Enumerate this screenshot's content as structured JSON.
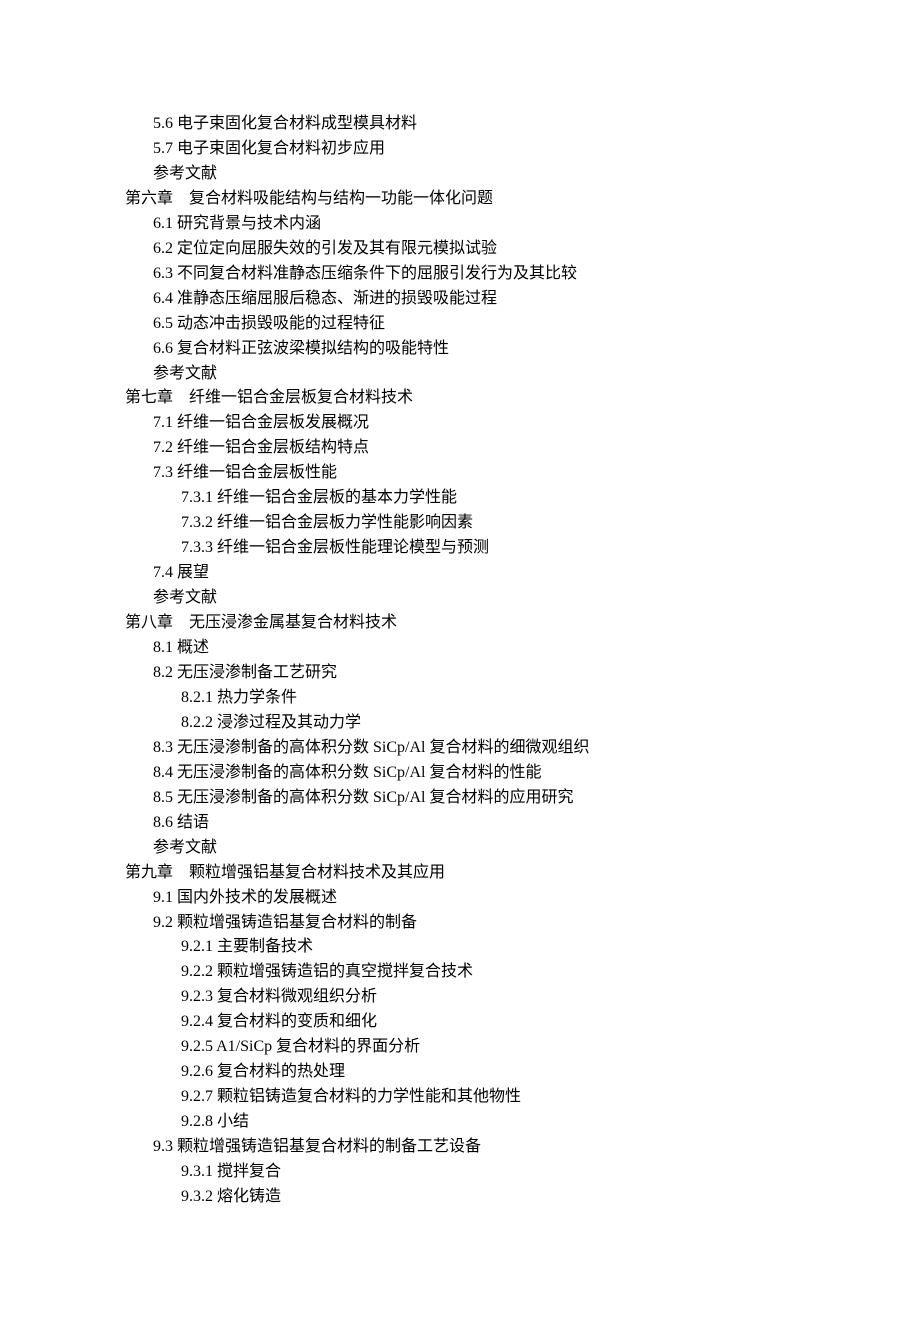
{
  "lines": [
    {
      "indent": 1,
      "text": "5.6 电子束固化复合材料成型模具材料"
    },
    {
      "indent": 1,
      "text": "5.7 电子束固化复合材料初步应用"
    },
    {
      "indent": 1,
      "text": "参考文献"
    },
    {
      "indent": 0,
      "text": "第六章　复合材料吸能结构与结构一功能一体化问题"
    },
    {
      "indent": 1,
      "text": "6.1 研究背景与技术内涵"
    },
    {
      "indent": 1,
      "text": "6.2 定位定向屈服失效的引发及其有限元模拟试验"
    },
    {
      "indent": 1,
      "text": "6.3 不同复合材料准静态压缩条件下的屈服引发行为及其比较"
    },
    {
      "indent": 1,
      "text": "6.4 准静态压缩屈服后稳态、渐进的损毁吸能过程"
    },
    {
      "indent": 1,
      "text": "6.5 动态冲击损毁吸能的过程特征"
    },
    {
      "indent": 1,
      "text": "6.6 复合材料正弦波梁模拟结构的吸能特性"
    },
    {
      "indent": 1,
      "text": "参考文献"
    },
    {
      "indent": 0,
      "text": "第七章　纤维一铝合金层板复合材料技术"
    },
    {
      "indent": 1,
      "text": "7.1 纤维一铝合金层板发展概况"
    },
    {
      "indent": 1,
      "text": "7.2 纤维一铝合金层板结构特点"
    },
    {
      "indent": 1,
      "text": "7.3 纤维一铝合金层板性能"
    },
    {
      "indent": 2,
      "text": "7.3.1 纤维一铝合金层板的基本力学性能"
    },
    {
      "indent": 2,
      "text": "7.3.2 纤维一铝合金层板力学性能影响因素"
    },
    {
      "indent": 2,
      "text": "7.3.3 纤维一铝合金层板性能理论模型与预测"
    },
    {
      "indent": 1,
      "text": "7.4 展望"
    },
    {
      "indent": 1,
      "text": "参考文献"
    },
    {
      "indent": 0,
      "text": "第八章　无压浸渗金属基复合材料技术"
    },
    {
      "indent": 1,
      "text": "8.1 概述"
    },
    {
      "indent": 1,
      "text": "8.2 无压浸渗制备工艺研究"
    },
    {
      "indent": 2,
      "text": "8.2.1 热力学条件"
    },
    {
      "indent": 2,
      "text": "8.2.2 浸渗过程及其动力学"
    },
    {
      "indent": 1,
      "text": "8.3 无压浸渗制备的高体积分数 SiCp/Al 复合材料的细微观组织"
    },
    {
      "indent": 1,
      "text": "8.4 无压浸渗制备的高体积分数 SiCp/Al 复合材料的性能"
    },
    {
      "indent": 1,
      "text": "8.5 无压浸渗制备的高体积分数 SiCp/Al 复合材料的应用研究"
    },
    {
      "indent": 1,
      "text": "8.6 结语"
    },
    {
      "indent": 1,
      "text": "参考文献"
    },
    {
      "indent": 0,
      "text": "第九章　颗粒增强铝基复合材料技术及其应用"
    },
    {
      "indent": 1,
      "text": "9.1 国内外技术的发展概述"
    },
    {
      "indent": 1,
      "text": "9.2 颗粒增强铸造铝基复合材料的制备"
    },
    {
      "indent": 2,
      "text": "9.2.1 主要制备技术"
    },
    {
      "indent": 2,
      "text": "9.2.2 颗粒增强铸造铝的真空搅拌复合技术"
    },
    {
      "indent": 2,
      "text": "9.2.3 复合材料微观组织分析"
    },
    {
      "indent": 2,
      "text": "9.2.4 复合材料的变质和细化"
    },
    {
      "indent": 2,
      "text": "9.2.5 A1/SiCp 复合材料的界面分析"
    },
    {
      "indent": 2,
      "text": "9.2.6 复合材料的热处理"
    },
    {
      "indent": 2,
      "text": "9.2.7 颗粒铝铸造复合材料的力学性能和其他物性"
    },
    {
      "indent": 2,
      "text": "9.2.8 小结"
    },
    {
      "indent": 1,
      "text": "9.3 颗粒增强铸造铝基复合材料的制备工艺设备"
    },
    {
      "indent": 2,
      "text": "9.3.1 搅拌复合"
    },
    {
      "indent": 2,
      "text": "9.3.2 熔化铸造"
    }
  ]
}
